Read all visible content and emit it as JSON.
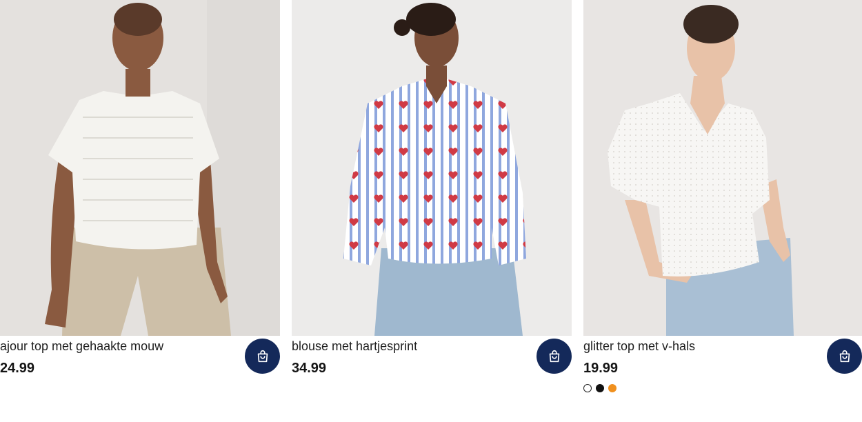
{
  "products": [
    {
      "name": "ajour top met gehaakte mouw",
      "price": "24.99",
      "cart_icon": "shopping-bag-icon",
      "image_desc_colors": {
        "backdrop": "#e4e1de",
        "top": "#f4f3ef",
        "pants": "#cdbfa8",
        "skin": "#8a5a40"
      }
    },
    {
      "name": "blouse met hartjesprint",
      "price": "34.99",
      "cart_icon": "shopping-bag-icon",
      "image_desc_colors": {
        "backdrop": "#ecebea",
        "stripe": "#8fa7de",
        "heart": "#d03a45",
        "jeans": "#9fb8cf",
        "skin": "#7a4e38"
      }
    },
    {
      "name": "glitter top met v-hals",
      "price": "19.99",
      "cart_icon": "shopping-bag-icon",
      "image_desc_colors": {
        "backdrop": "#e8e5e3",
        "top": "#f7f6f4",
        "jeans": "#a9bfd4",
        "skin": "#e8c2a8",
        "hair": "#3a2a22"
      },
      "swatches": [
        {
          "color": "#ffffff",
          "selected": true
        },
        {
          "color": "#111111",
          "selected": false
        },
        {
          "color": "#f0901e",
          "selected": false
        }
      ]
    }
  ],
  "theme": {
    "cart_button_bg": "#14295a",
    "cart_icon_color": "#ffffff"
  }
}
